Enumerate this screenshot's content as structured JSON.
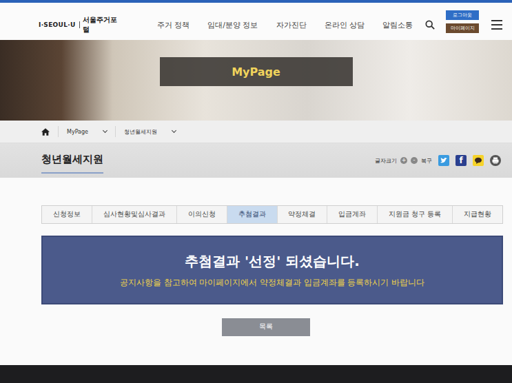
{
  "header": {
    "logo": "I·SEOUL·U",
    "site_name": "서울주거포털",
    "nav": [
      "주거 정책",
      "임대/분양 정보",
      "자가진단",
      "온라인 상담",
      "알림소통"
    ],
    "logout": "로그아웃",
    "mypage": "마이페이지"
  },
  "banner": {
    "title": "MyPage"
  },
  "breadcrumb": [
    {
      "label": "MyPage"
    },
    {
      "label": "청년월세지원"
    }
  ],
  "page": {
    "title": "청년월세지원",
    "font_size": {
      "label": "글자크기",
      "plus": "+",
      "minus": "-",
      "reset": "복구"
    },
    "facebook_glyph": "f"
  },
  "tabs": [
    {
      "label": "신청정보",
      "selected": false
    },
    {
      "label": "심사현황및심사결과",
      "selected": false
    },
    {
      "label": "이의신청",
      "selected": false
    },
    {
      "label": "추첨결과",
      "selected": true
    },
    {
      "label": "약정체결",
      "selected": false
    },
    {
      "label": "입금계좌",
      "selected": false
    },
    {
      "label": "지원금 청구 등록",
      "selected": false
    },
    {
      "label": "지급현황",
      "selected": false
    }
  ],
  "notice": {
    "title": "추첨결과 '선정' 되셨습니다.",
    "message": "공지사항을 참고하여 마이페이지에서 약정체결과 입금계좌를 등록하시기 바랍니다"
  },
  "button": "목록"
}
